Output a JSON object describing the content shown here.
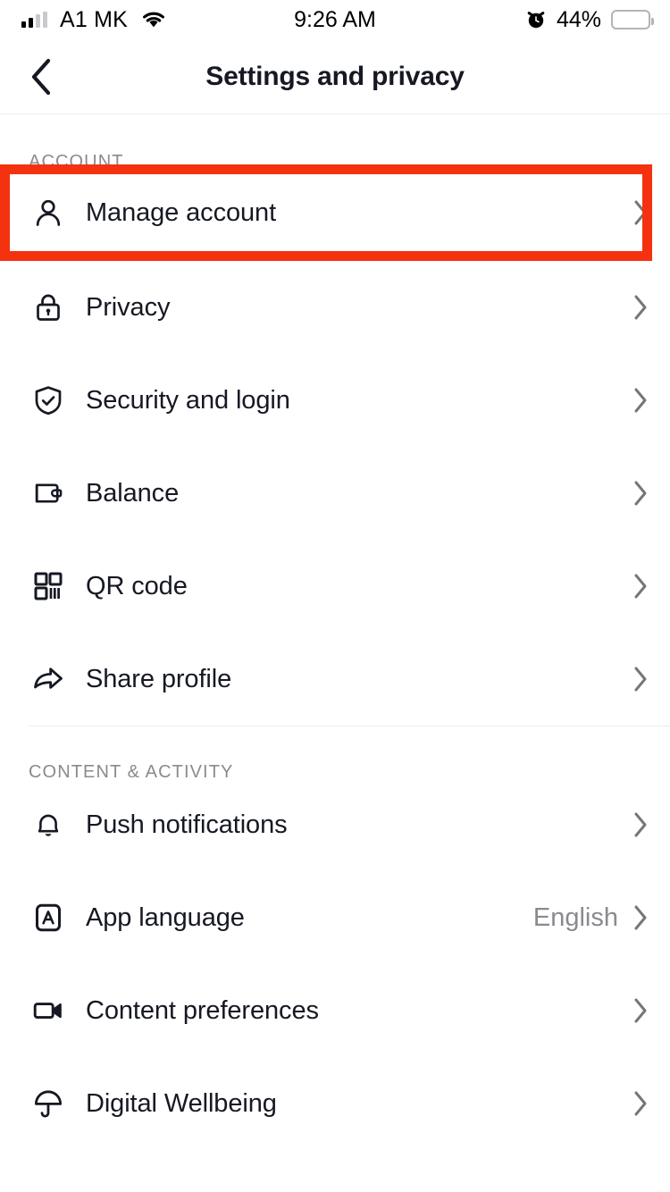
{
  "statusbar": {
    "carrier": "A1 MK",
    "time": "9:26 AM",
    "battery_percent": "44%",
    "battery_level": 44,
    "signal_bars_filled": 2,
    "signal_bars_total": 4,
    "wifi_icon": "wifi-icon",
    "alarm_icon": "alarm-clock-icon",
    "battery_color": "#FDC81A"
  },
  "header": {
    "title": "Settings and privacy",
    "back_icon": "chevron-left-icon"
  },
  "highlight": {
    "color": "#F4320F",
    "target": "Manage account"
  },
  "sections": [
    {
      "id": "account",
      "header": "ACCOUNT",
      "rows": [
        {
          "label": "Manage account",
          "icon": "person-icon",
          "value": ""
        },
        {
          "label": "Privacy",
          "icon": "lock-icon",
          "value": ""
        },
        {
          "label": "Security and login",
          "icon": "shield-check-icon",
          "value": ""
        },
        {
          "label": "Balance",
          "icon": "wallet-icon",
          "value": ""
        },
        {
          "label": "QR code",
          "icon": "qr-code-icon",
          "value": ""
        },
        {
          "label": "Share profile",
          "icon": "share-arrow-icon",
          "value": ""
        }
      ]
    },
    {
      "id": "content",
      "header": "CONTENT & ACTIVITY",
      "rows": [
        {
          "label": "Push notifications",
          "icon": "bell-icon",
          "value": ""
        },
        {
          "label": "App language",
          "icon": "language-a-icon",
          "value": "English"
        },
        {
          "label": "Content preferences",
          "icon": "video-camera-icon",
          "value": ""
        },
        {
          "label": "Digital Wellbeing",
          "icon": "umbrella-icon",
          "value": ""
        }
      ]
    }
  ],
  "chevron_icon": "chevron-right-icon",
  "colors": {
    "text_primary": "#161823",
    "text_secondary": "#8a8a8f",
    "chevron": "#76767a",
    "divider": "#ebebec",
    "highlight": "#F4320F"
  }
}
